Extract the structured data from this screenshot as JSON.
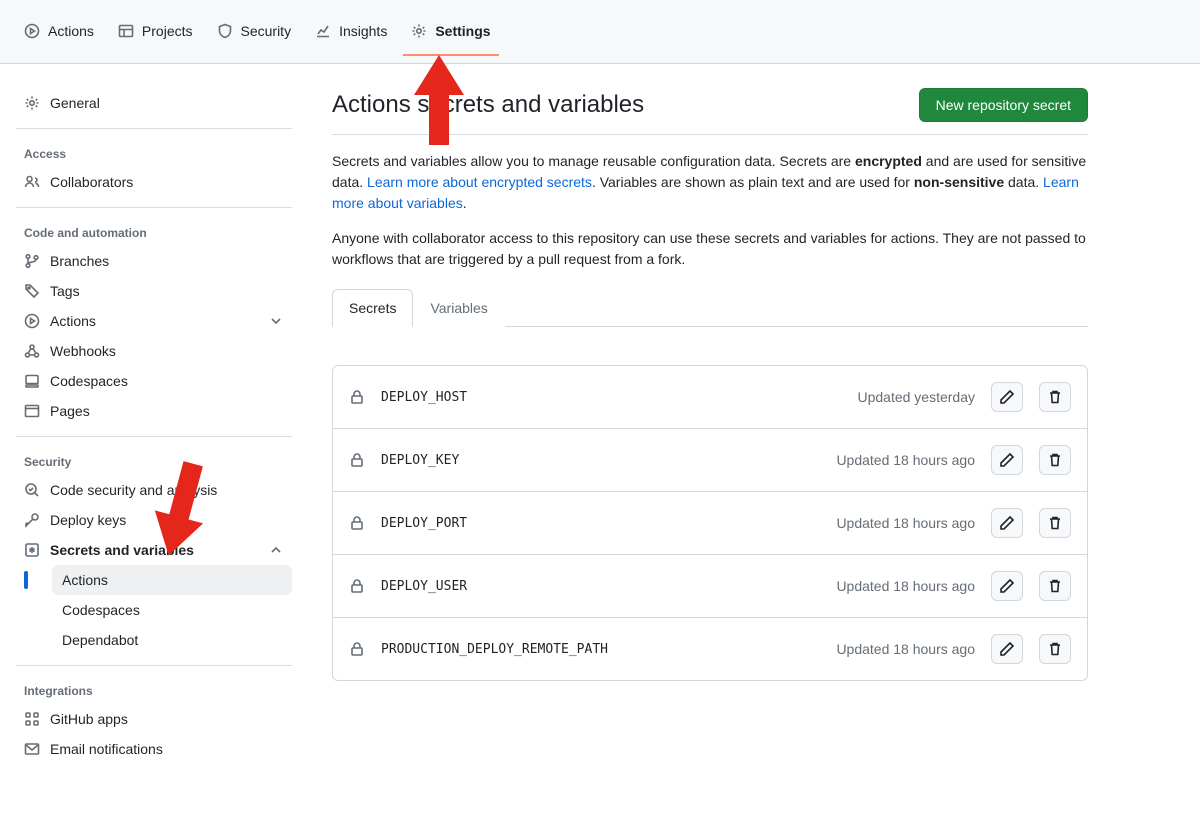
{
  "topnav": {
    "actions": "Actions",
    "projects": "Projects",
    "security": "Security",
    "insights": "Insights",
    "settings": "Settings"
  },
  "sidebar": {
    "general": "General",
    "access_heading": "Access",
    "collaborators": "Collaborators",
    "code_heading": "Code and automation",
    "branches": "Branches",
    "tags": "Tags",
    "actions": "Actions",
    "webhooks": "Webhooks",
    "codespaces": "Codespaces",
    "pages": "Pages",
    "security_heading": "Security",
    "code_security": "Code security and analysis",
    "deploy_keys": "Deploy keys",
    "secrets_variables": "Secrets and variables",
    "sv_actions": "Actions",
    "sv_codespaces": "Codespaces",
    "sv_dependabot": "Dependabot",
    "integrations_heading": "Integrations",
    "github_apps": "GitHub apps",
    "email_notifications": "Email notifications"
  },
  "page": {
    "title": "Actions secrets and variables",
    "new_btn": "New repository secret",
    "desc1a": "Secrets and variables allow you to manage reusable configuration data. Secrets are ",
    "desc1b": "encrypted",
    "desc1c": " and are used for sensitive data. ",
    "link1": "Learn more about encrypted secrets",
    "desc1d": ". Variables are shown as plain text and are used for ",
    "desc1e": "non-sensitive",
    "desc1f": " data. ",
    "link2": "Learn more about variables",
    "desc1g": ".",
    "desc2": "Anyone with collaborator access to this repository can use these secrets and variables for actions. They are not passed to workflows that are triggered by a pull request from a fork.",
    "tab_secrets": "Secrets",
    "tab_variables": "Variables"
  },
  "secrets": [
    {
      "name": "DEPLOY_HOST",
      "updated": "Updated yesterday"
    },
    {
      "name": "DEPLOY_KEY",
      "updated": "Updated 18 hours ago"
    },
    {
      "name": "DEPLOY_PORT",
      "updated": "Updated 18 hours ago"
    },
    {
      "name": "DEPLOY_USER",
      "updated": "Updated 18 hours ago"
    },
    {
      "name": "PRODUCTION_DEPLOY_REMOTE_PATH",
      "updated": "Updated 18 hours ago"
    }
  ],
  "colors": {
    "accent_green": "#1f883d",
    "link": "#0969da",
    "arrow": "#e4261b"
  }
}
